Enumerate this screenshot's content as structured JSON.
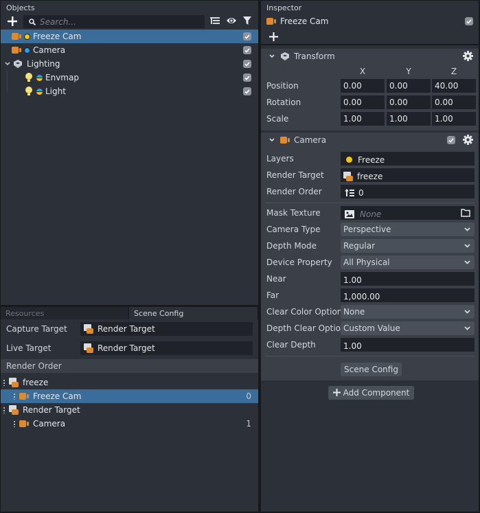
{
  "objects": {
    "header": "Objects",
    "search_placeholder": "Search...",
    "items": [
      {
        "label": "Freeze Cam",
        "type": "camera",
        "layer_color": "#f5c518",
        "checked": true,
        "selected": true
      },
      {
        "label": "Camera",
        "type": "camera",
        "layer_color": "#2aa0e8",
        "checked": true,
        "selected": false
      },
      {
        "label": "Lighting",
        "type": "group",
        "checked": true,
        "expanded": true
      },
      {
        "label": "Envmap",
        "type": "light",
        "checked": true,
        "child": true
      },
      {
        "label": "Light",
        "type": "light",
        "checked": true,
        "child": true
      }
    ]
  },
  "bottom_tabs": [
    {
      "label": "Resources",
      "active": false
    },
    {
      "label": "Scene Config",
      "active": true
    }
  ],
  "scene_config": {
    "fields": [
      {
        "label": "Capture Target",
        "value": "Render Target"
      },
      {
        "label": "Live Target",
        "value": "Render Target"
      }
    ],
    "render_order_header": "Render Order",
    "render_order": [
      {
        "label": "freeze",
        "type": "target"
      },
      {
        "label": "Freeze Cam",
        "type": "camera",
        "order": "0",
        "selected": true
      },
      {
        "label": "Render Target",
        "type": "target"
      },
      {
        "label": "Camera",
        "type": "camera",
        "order": "1"
      }
    ]
  },
  "inspector": {
    "header": "Inspector",
    "object_name": "Freeze Cam",
    "object_enabled": true,
    "transform": {
      "title": "Transform",
      "axes": [
        "X",
        "Y",
        "Z"
      ],
      "rows": [
        {
          "label": "Position",
          "values": [
            "0.00",
            "0.00",
            "40.00"
          ]
        },
        {
          "label": "Rotation",
          "values": [
            "0.00",
            "0.00",
            "0.00"
          ]
        },
        {
          "label": "Scale",
          "values": [
            "1.00",
            "1.00",
            "1.00"
          ]
        }
      ]
    },
    "camera": {
      "title": "Camera",
      "enabled": true,
      "layers": {
        "label": "Layers",
        "value": "Freeze",
        "color": "#f5c518"
      },
      "render_target": {
        "label": "Render Target",
        "value": "freeze"
      },
      "render_order": {
        "label": "Render Order",
        "value": "0"
      },
      "mask_texture": {
        "label": "Mask Texture",
        "value": "None"
      },
      "camera_type": {
        "label": "Camera Type",
        "value": "Perspective"
      },
      "depth_mode": {
        "label": "Depth Mode",
        "value": "Regular"
      },
      "device_property": {
        "label": "Device Property",
        "value": "All Physical"
      },
      "near": {
        "label": "Near",
        "value": "1.00"
      },
      "far": {
        "label": "Far",
        "value": "1,000.00"
      },
      "clear_color_option": {
        "label": "Clear Color Option",
        "value": "None"
      },
      "depth_clear_option": {
        "label": "Depth Clear Option",
        "value": "Custom Value"
      },
      "clear_depth": {
        "label": "Clear Depth",
        "value": "1.00"
      },
      "scene_config_button": "Scene Config"
    },
    "add_component_button": "Add Component"
  },
  "colors": {
    "selection": "#3a6d9a",
    "camera_icon": "#e08a2e",
    "panel_bg": "#2c3038",
    "section_bg": "#3a3f48"
  }
}
